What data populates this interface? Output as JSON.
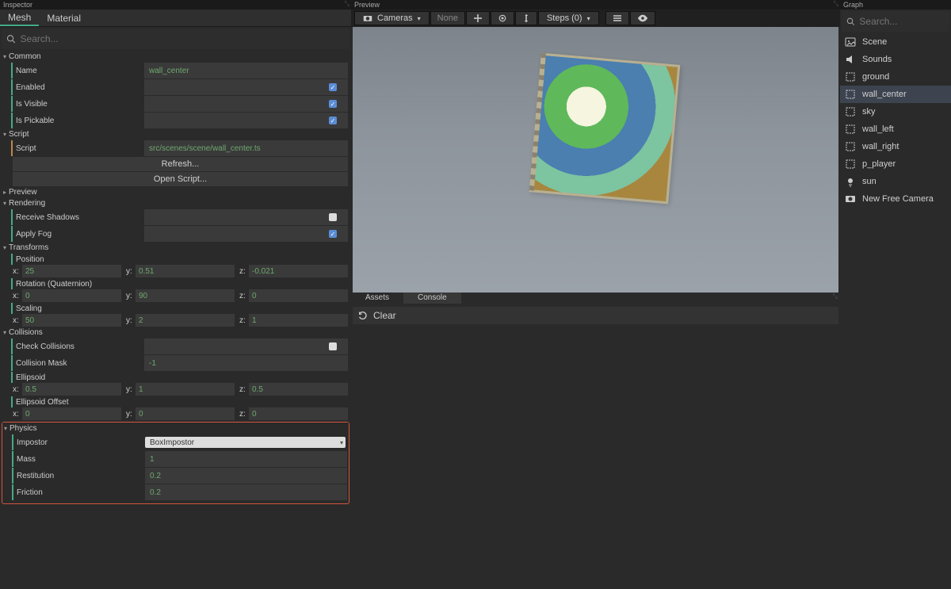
{
  "inspector": {
    "header": "Inspector",
    "tabs": {
      "mesh": "Mesh",
      "material": "Material"
    }
  },
  "search_placeholder": "Search...",
  "common": {
    "header": "Common",
    "name_label": "Name",
    "name_value": "wall_center",
    "enabled_label": "Enabled",
    "visible_label": "Is Visible",
    "pickable_label": "Is Pickable"
  },
  "script": {
    "header": "Script",
    "script_label": "Script",
    "script_value": "src/scenes/scene/wall_center.ts",
    "refresh": "Refresh...",
    "open": "Open Script..."
  },
  "preview_section": "Preview",
  "rendering": {
    "header": "Rendering",
    "receive_shadows": "Receive Shadows",
    "apply_fog": "Apply Fog"
  },
  "transforms": {
    "header": "Transforms",
    "position": "Position",
    "pos": {
      "x": "25",
      "y": "0.51",
      "z": "-0.021"
    },
    "rotation": "Rotation (Quaternion)",
    "rot": {
      "x": "0",
      "y": "90",
      "z": "0"
    },
    "scaling": "Scaling",
    "scl": {
      "x": "50",
      "y": "2",
      "z": "1"
    }
  },
  "collisions": {
    "header": "Collisions",
    "check": "Check Collisions",
    "mask_label": "Collision Mask",
    "mask_value": "-1",
    "ellipsoid": "Ellipsoid",
    "ell": {
      "x": "0.5",
      "y": "1",
      "z": "0.5"
    },
    "offset": "Ellipsoid Offset",
    "off": {
      "x": "0",
      "y": "0",
      "z": "0"
    }
  },
  "physics": {
    "header": "Physics",
    "impostor_label": "Impostor",
    "impostor_value": "BoxImpostor",
    "mass_label": "Mass",
    "mass_value": "1",
    "restitution_label": "Restitution",
    "restitution_value": "0.2",
    "friction_label": "Friction",
    "friction_value": "0.2"
  },
  "preview_panel": {
    "header": "Preview",
    "cameras": "Cameras",
    "none": "None",
    "steps": "Steps (0)"
  },
  "assets_tab": "Assets",
  "console_tab": "Console",
  "clear": "Clear",
  "graph": {
    "header": "Graph",
    "items": [
      {
        "label": "Scene",
        "icon": "image"
      },
      {
        "label": "Sounds",
        "icon": "speaker"
      },
      {
        "label": "ground",
        "icon": "mesh"
      },
      {
        "label": "wall_center",
        "icon": "mesh",
        "selected": true
      },
      {
        "label": "sky",
        "icon": "mesh"
      },
      {
        "label": "wall_left",
        "icon": "mesh"
      },
      {
        "label": "wall_right",
        "icon": "mesh"
      },
      {
        "label": "p_player",
        "icon": "mesh"
      },
      {
        "label": "sun",
        "icon": "light"
      },
      {
        "label": "New Free Camera",
        "icon": "camera"
      }
    ]
  },
  "axis": {
    "x": "x:",
    "y": "y:",
    "z": "z:"
  }
}
